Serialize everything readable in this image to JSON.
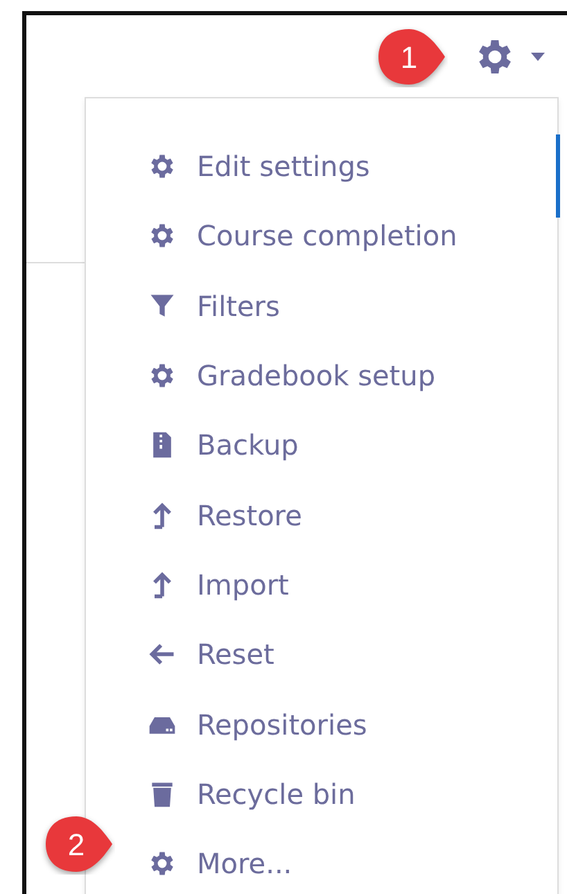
{
  "menu": {
    "items": [
      {
        "label": "Edit settings"
      },
      {
        "label": "Course completion"
      },
      {
        "label": "Filters"
      },
      {
        "label": "Gradebook setup"
      },
      {
        "label": "Backup"
      },
      {
        "label": "Restore"
      },
      {
        "label": "Import"
      },
      {
        "label": "Reset"
      },
      {
        "label": "Repositories"
      },
      {
        "label": "Recycle bin"
      },
      {
        "label": "More..."
      }
    ]
  },
  "callouts": [
    {
      "label": "1"
    },
    {
      "label": "2"
    }
  ]
}
